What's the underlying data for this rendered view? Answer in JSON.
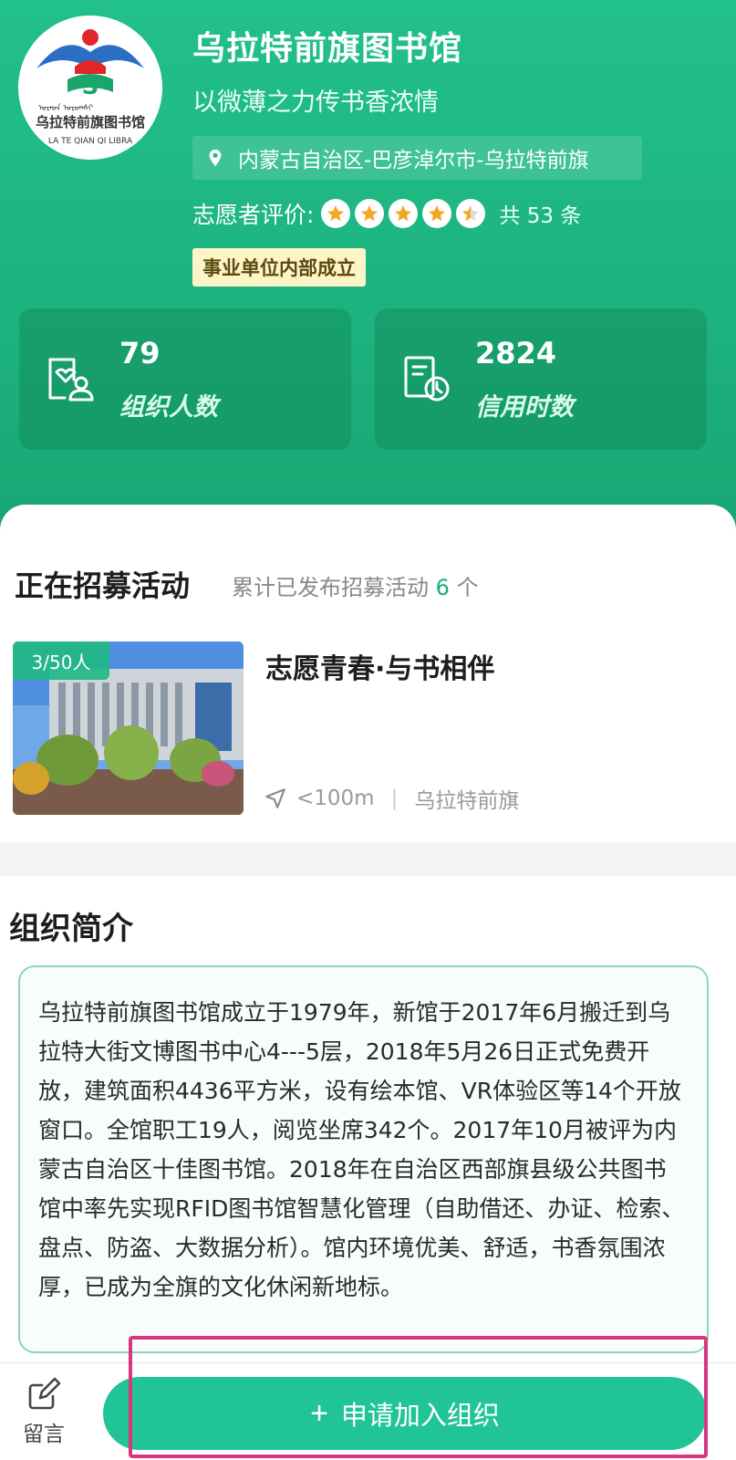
{
  "org": {
    "name": "乌拉特前旗图书馆",
    "slogan": "以微薄之力传书香浓情",
    "location": "内蒙古自治区-巴彦淖尔市-乌拉特前旗",
    "rating_label": "志愿者评价:",
    "rating_stars": 4.5,
    "rating_count": "共 53 条",
    "tag": "事业单位内部成立",
    "logo_text_cn": "乌拉特前旗图书馆",
    "logo_text_en": "LA TE QIAN QI LIBRA"
  },
  "stats": [
    {
      "value": "79",
      "label": "组织人数",
      "icon": "people-icon"
    },
    {
      "value": "2824",
      "label": "信用时数",
      "icon": "clock-document-icon"
    }
  ],
  "recruiting": {
    "title": "正在招募活动",
    "summary_prefix": "累计已发布招募活动",
    "summary_count": "6",
    "summary_suffix": "个",
    "activities": [
      {
        "badge": "3/50人",
        "title": "志愿青春·与书相伴",
        "distance": "<100m",
        "area": "乌拉特前旗"
      }
    ]
  },
  "intro": {
    "title": "组织简介",
    "text": "乌拉特前旗图书馆成立于1979年，新馆于2017年6月搬迁到乌拉特大街文博图书中心4---5层，2018年5月26日正式免费开放，建筑面积4436平方米，设有绘本馆、VR体验区等14个开放窗口。全馆职工19人，阅览坐席342个。2017年10月被评为内蒙古自治区十佳图书馆。2018年在自治区西部旗县级公共图书馆中率先实现RFID图书馆智慧化管理（自助借还、办证、检索、盘点、防盗、大数据分析）。馆内环境优美、舒适，书香氛围浓厚，已成为全旗的文化休闲新地标。"
  },
  "bottom": {
    "message_label": "留言",
    "join_label": "申请加入组织",
    "join_icon": "+"
  },
  "colors": {
    "header_green": "#1db37f",
    "accent": "#20c497",
    "star": "#f5a623",
    "highlight": "#d8377f"
  }
}
